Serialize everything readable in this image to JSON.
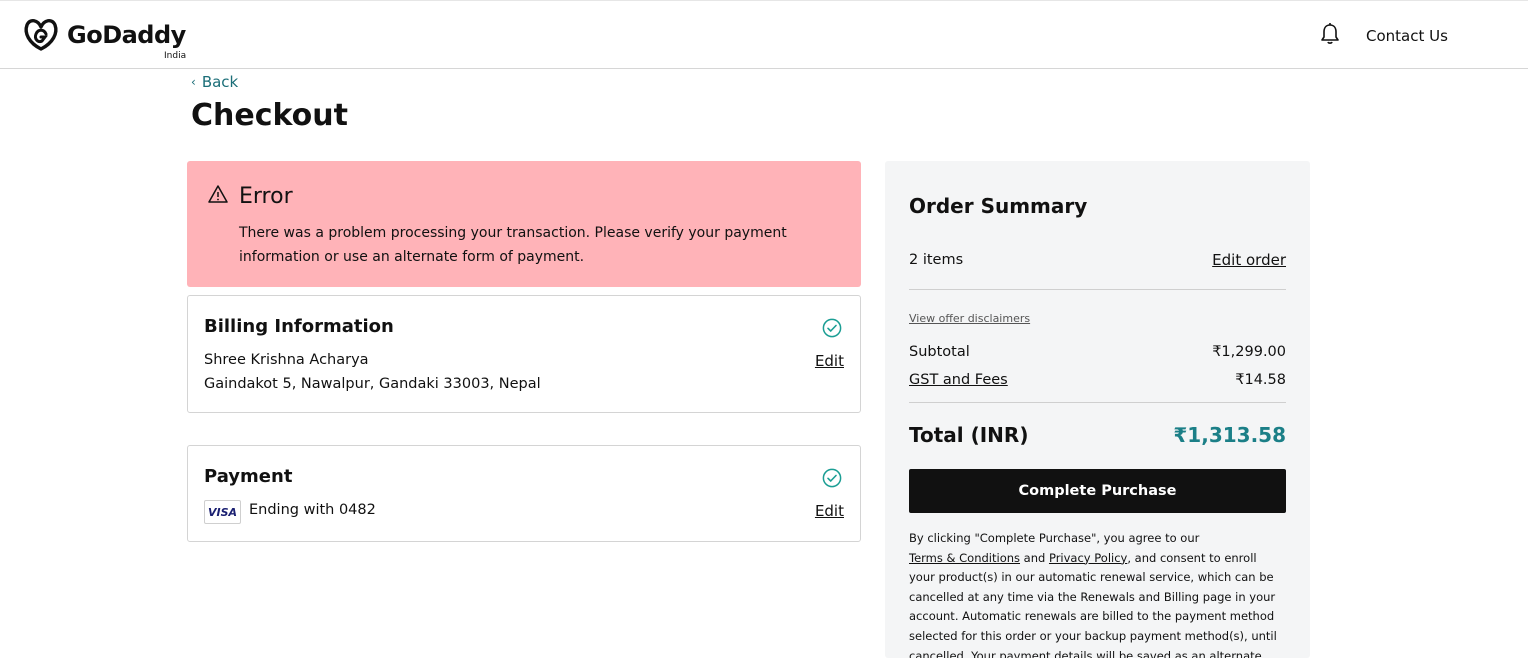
{
  "header": {
    "logo_text": "GoDaddy",
    "logo_region": "India",
    "contact_label": "Contact Us"
  },
  "nav": {
    "back_label": "Back"
  },
  "page": {
    "title": "Checkout"
  },
  "error": {
    "title": "Error",
    "message": "There was a problem processing your transaction. Please verify your payment information or use an alternate form of payment."
  },
  "billing": {
    "title": "Billing Information",
    "name": "Shree Krishna Acharya",
    "address": "Gaindakot 5, Nawalpur, Gandaki 33003, Nepal",
    "edit_label": "Edit"
  },
  "payment": {
    "title": "Payment",
    "card_brand": "VISA",
    "card_text": "Ending with 0482",
    "edit_label": "Edit"
  },
  "summary": {
    "title": "Order Summary",
    "items_count": "2 items",
    "edit_order_label": "Edit order",
    "disclaimers_label": "View offer disclaimers",
    "subtotal_label": "Subtotal",
    "subtotal_value": "₹1,299.00",
    "gst_label": "GST and Fees",
    "gst_value": "₹14.58",
    "total_label": "Total (INR)",
    "total_value": "₹1,313.58",
    "button_label": "Complete Purchase",
    "legal_1": "By clicking \"Complete Purchase\", you agree to our",
    "legal_terms": "Terms & Conditions",
    "legal_and": " and ",
    "legal_privacy": "Privacy Policy",
    "legal_2": ", and consent to enroll your product(s) in our automatic renewal service, which can be cancelled at any time via the Renewals and Billing page in your account. Automatic renewals are billed to the payment method selected for this order or your backup payment method(s), until cancelled. Your payment details will be saved as an alternate"
  },
  "colors": {
    "error_bg": "#ffb3b8",
    "accent_teal": "#1b7f87",
    "button_bg": "#111111",
    "summary_bg": "#f4f5f6"
  },
  "icons": [
    "godaddy-logo-icon",
    "bell-icon",
    "chevron-left-icon",
    "warning-icon",
    "check-circle-icon",
    "visa-icon"
  ]
}
